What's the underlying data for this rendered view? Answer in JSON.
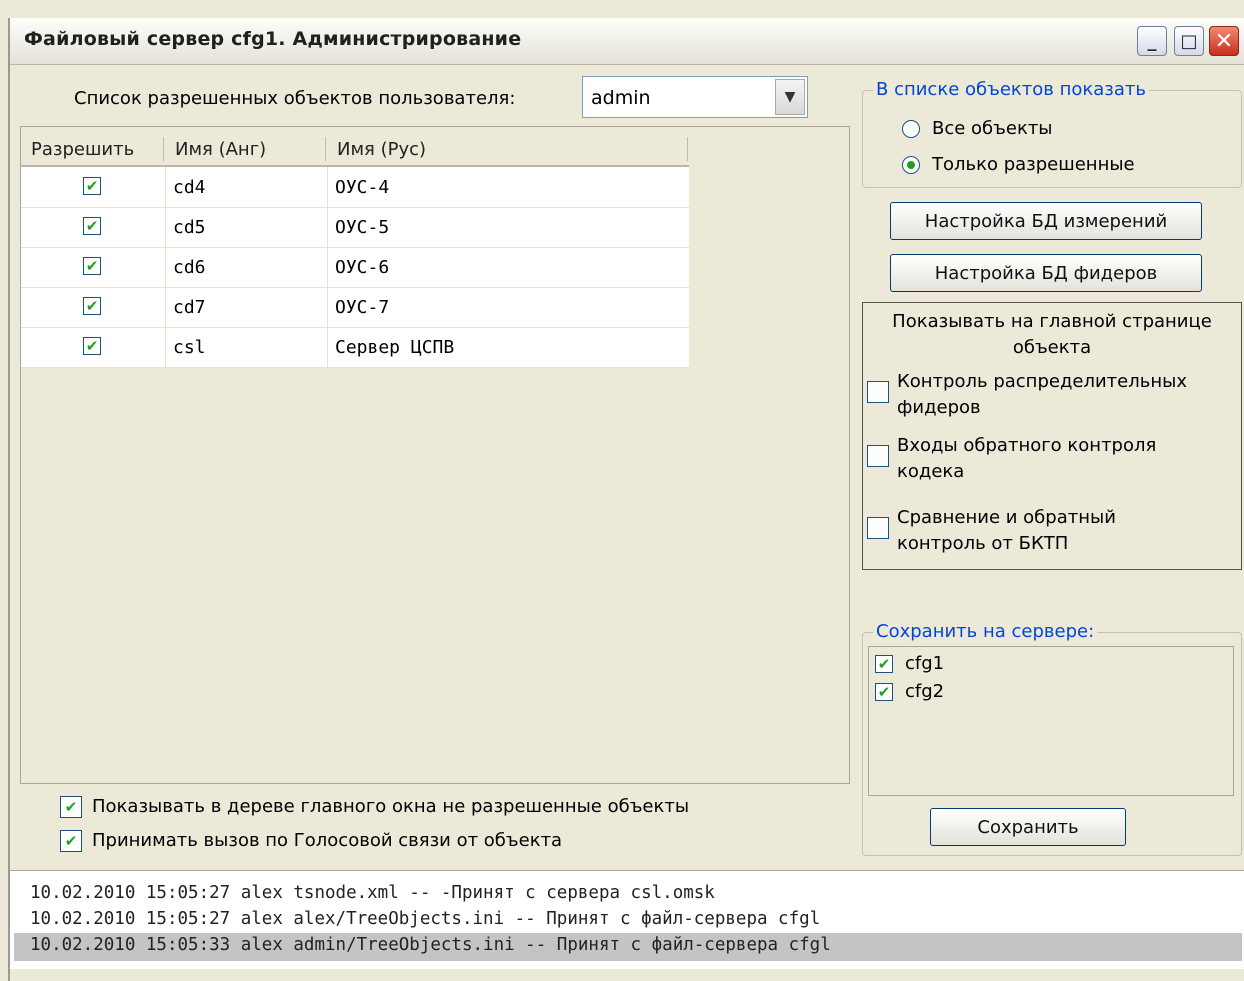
{
  "window": {
    "title": "Файловый сервер cfg1. Администрирование"
  },
  "titlebar_buttons": {
    "minimize": "_",
    "maximize": "□",
    "close": "✕"
  },
  "user_select": {
    "label": "Список разрешенных объектов пользователя:",
    "value": "admin"
  },
  "table": {
    "columns": [
      "Разрешить",
      "Имя (Анг)",
      "Имя (Рус)"
    ],
    "rows": [
      {
        "allowed": true,
        "name_en": "cd4",
        "name_ru": "ОУС-4"
      },
      {
        "allowed": true,
        "name_en": "cd5",
        "name_ru": "ОУС-5"
      },
      {
        "allowed": true,
        "name_en": "cd6",
        "name_ru": "ОУС-6"
      },
      {
        "allowed": true,
        "name_en": "cd7",
        "name_ru": "ОУС-7"
      },
      {
        "allowed": true,
        "name_en": "csl",
        "name_ru": "Сервер ЦСПВ"
      }
    ]
  },
  "show_group": {
    "legend": "В списке объектов показать",
    "options": [
      {
        "label": "Все объекты",
        "selected": false
      },
      {
        "label": "Только разрешенные",
        "selected": true
      }
    ]
  },
  "buttons": {
    "db_measure": "Настройка БД измерений",
    "db_feeders": "Настройка БД фидеров",
    "save": "Сохранить"
  },
  "main_page": {
    "title_line1": "Показывать на главной странице",
    "title_line2": "объекта",
    "options": [
      {
        "line1": "Контроль распределительных",
        "line2": "фидеров",
        "checked": false
      },
      {
        "line1": "Входы обратного контроля",
        "line2": "кодека",
        "checked": false
      },
      {
        "line1": "Сравнение и обратный",
        "line2": "контроль от БКТП",
        "checked": false
      }
    ]
  },
  "save_group": {
    "legend": "Сохранить на сервере:",
    "servers": [
      {
        "label": "cfg1",
        "checked": true
      },
      {
        "label": "cfg2",
        "checked": true
      }
    ]
  },
  "bottom_options": [
    {
      "label": "Показывать в дереве главного окна не разрешенные объекты",
      "checked": true
    },
    {
      "label": "Принимать вызов по Голосовой связи от объекта",
      "checked": true
    }
  ],
  "log": [
    "10.02.2010 15:05:27 alex tsnode.xml -- -Принят с сервера csl.omsk",
    "10.02.2010 15:05:27 alex alex/TreeObjects.ini -- Принят с файл-сервера cfgl",
    "10.02.2010 15:05:33 alex admin/TreeObjects.ini -- Принят с файл-сервера cfgl"
  ],
  "colors": {
    "window_bg": "#ece9d8",
    "legend_text": "#0046d5",
    "check_green": "#21a121",
    "selected_log_row": "#c4c4c4"
  }
}
